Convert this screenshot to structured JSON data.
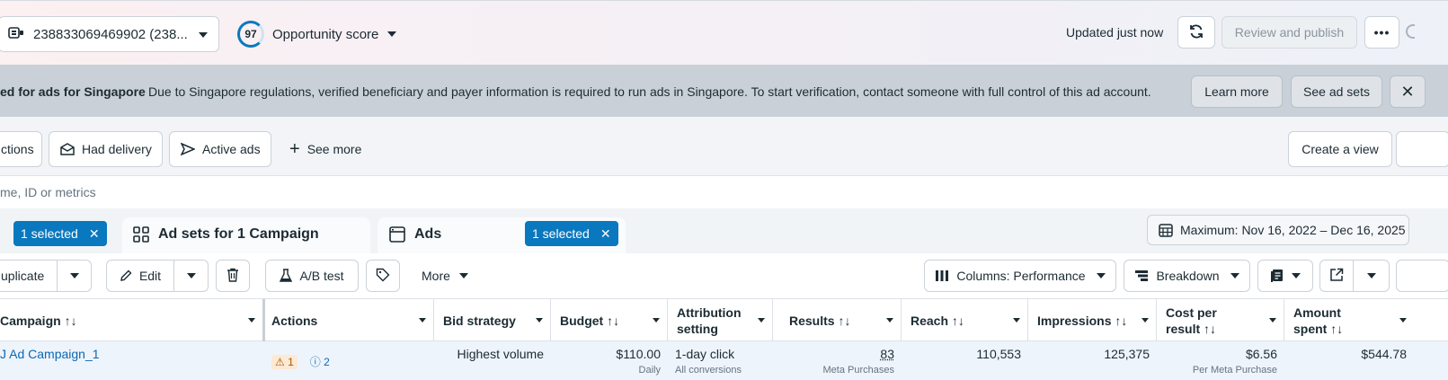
{
  "topbar": {
    "account_label": "238833069469902 (238...",
    "opportunity_score": "97",
    "opportunity_label": "Opportunity score",
    "updated_text": "Updated just now",
    "review_publish": "Review and publish",
    "more_label": "•••"
  },
  "banner": {
    "title": "ed for ads for Singapore",
    "message": "Due to Singapore regulations, verified beneficiary and payer information is required to run ads in Singapore. To start verification, contact someone with full control of this ad account.",
    "learn_more": "Learn more",
    "see_ad_sets": "See ad sets",
    "close": "✕"
  },
  "filters": {
    "chip_actions": "ctions",
    "chip_had_delivery": "Had delivery",
    "chip_active_ads": "Active ads",
    "see_more": "See more",
    "create_view": "Create a view"
  },
  "search": {
    "placeholder": "me, ID or metrics"
  },
  "tabs": {
    "campaigns_selected": "1 selected",
    "adsets_label": "Ad sets for 1 Campaign",
    "ads_label": "Ads",
    "ads_selected": "1 selected",
    "date_range": "Maximum: Nov 16, 2022 – Dec 16, 2025"
  },
  "toolbar": {
    "duplicate": "uplicate",
    "edit": "Edit",
    "ab_test": "A/B test",
    "more": "More",
    "columns": "Columns: Performance",
    "breakdown": "Breakdown"
  },
  "table": {
    "headers": {
      "campaign": "Campaign ↑↓",
      "actions": "Actions",
      "bid_strategy": "Bid strategy",
      "budget": "Budget ↑↓",
      "attribution": "Attribution setting",
      "results": "Results ↑↓",
      "reach": "Reach ↑↓",
      "impressions": "Impressions ↑↓",
      "cost_per_result": "Cost per result ↑↓",
      "amount_spent": "Amount spent ↑↓"
    },
    "row": {
      "campaign": "J Ad Campaign_1",
      "warn_count": "1",
      "info_count": "2",
      "bid_strategy": "Highest volume",
      "budget": "$110.00",
      "budget_sub": "Daily",
      "attribution": "1-day click",
      "attribution_sub": "All conversions",
      "results": "83",
      "results_sub": "Meta Purchases",
      "reach": "110,553",
      "impressions": "125,375",
      "cost_per_result": "$6.56",
      "cost_per_result_sub": "Per Meta Purchase",
      "amount_spent": "$544.78"
    }
  },
  "colors": {
    "accent": "#0a78be",
    "banner_bg": "#c9d0d7",
    "link": "#0a68b4"
  }
}
